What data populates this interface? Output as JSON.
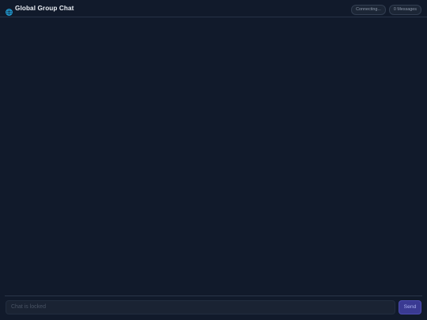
{
  "header": {
    "title": "Global Group Chat",
    "icon": "globe-icon",
    "status_label": "Connecting...",
    "message_count_label": "0 Messages"
  },
  "composer": {
    "placeholder": "Chat is locked",
    "send_label": "Send"
  },
  "colors": {
    "background": "#111a2b",
    "accent": "#3a3a92",
    "globe": "#22a6e0"
  }
}
